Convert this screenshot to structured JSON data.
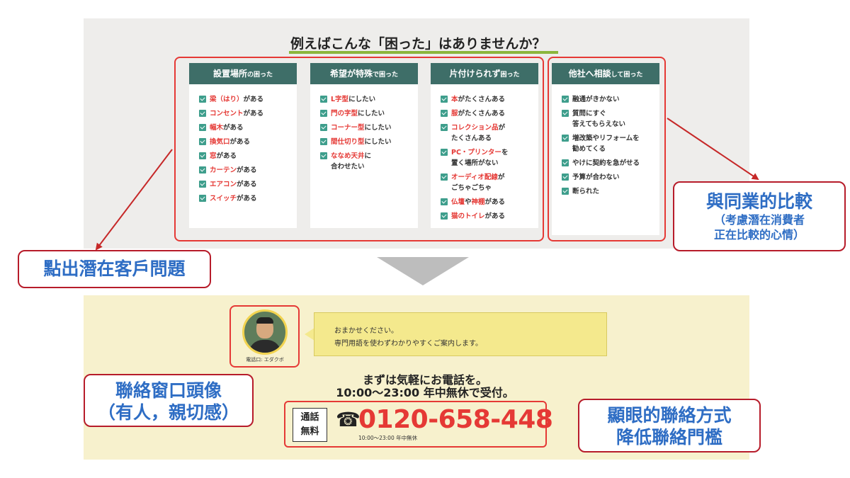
{
  "heading": "例えばこんな「困った」はありませんか？",
  "cards": [
    {
      "title_main": "設置場所",
      "title_sub": "の困った",
      "items": [
        {
          "hl": "梁（はり）",
          "rest": "がある"
        },
        {
          "hl": "コンセント",
          "rest": "がある"
        },
        {
          "hl": "幅木",
          "rest": "がある"
        },
        {
          "hl": "換気口",
          "rest": "がある"
        },
        {
          "hl": "窓",
          "rest": "がある"
        },
        {
          "hl": "カーテン",
          "rest": "がある"
        },
        {
          "hl": "エアコン",
          "rest": "がある"
        },
        {
          "hl": "スイッチ",
          "rest": "がある"
        }
      ]
    },
    {
      "title_main": "希望が特殊",
      "title_sub": "で困った",
      "items": [
        {
          "hl": "L字型",
          "rest": "にしたい"
        },
        {
          "hl": "門の字型",
          "rest": "にしたい"
        },
        {
          "hl": "コーナー型",
          "rest": "にしたい"
        },
        {
          "hl": "間仕切り型",
          "rest": "にしたい"
        },
        {
          "hl": "ななめ天井",
          "rest": "に",
          "line2": "合わせたい"
        }
      ]
    },
    {
      "title_main": "片付けられず",
      "title_sub": "困った",
      "items": [
        {
          "hl": "本",
          "rest": "がたくさんある"
        },
        {
          "hl": "服",
          "rest": "がたくさんある"
        },
        {
          "hl": "コレクション品",
          "rest": "が",
          "line2": "たくさんある"
        },
        {
          "hl": "PC・プリンター",
          "rest": "を",
          "line2": "置く場所がない"
        },
        {
          "hl": "オーディオ配線",
          "rest": "が",
          "line2": "ごちゃごちゃ"
        },
        {
          "hl": "仏壇",
          "mid": "や",
          "hl2": "神棚",
          "rest": "がある"
        },
        {
          "hl": "猫のトイレ",
          "rest": "がある"
        }
      ]
    },
    {
      "title_main": "他社へ相談",
      "title_sub": "して困った",
      "items": [
        {
          "hl": "",
          "rest": "融通がきかない"
        },
        {
          "hl": "",
          "rest": "質問にすぐ",
          "line2": "答えてもらえない"
        },
        {
          "hl": "",
          "rest": "増改築やリフォームを",
          "line2": "勧めてくる"
        },
        {
          "hl": "",
          "rest": "やけに契約を急がせる"
        },
        {
          "hl": "",
          "rest": "予算が合わない"
        },
        {
          "hl": "",
          "rest": "断られた"
        }
      ]
    }
  ],
  "contact": {
    "avatar_caption": "電話口: エダクボ",
    "bubble_line1": "おまかせください。",
    "bubble_line2": "専門用語を使わずわかりやすくご案内します。",
    "callout_line1": "まずは気軽にお電話を。",
    "callout_line2": "10:00～23:00 年中無休で受付。",
    "free_label_1": "通話",
    "free_label_2": "無料",
    "phone_icon": "☎",
    "phone_number": "0120-658-448",
    "phone_hours": "10:00～23:00 年中無休"
  },
  "annotations": {
    "compare_title": "與同業的比較",
    "compare_sub1": "（考慮潛在消費者",
    "compare_sub2": "正在比較的心情）",
    "problem": "點出潛在客戶問題",
    "avatar_line1": "聯絡窗口頭像",
    "avatar_line2": "（有人，親切感）",
    "cta_line1": "顯眼的聯絡方式",
    "cta_line2": "降低聯絡門檻"
  },
  "colors": {
    "card_header": "#3e6e68",
    "check": "#3e9e8c",
    "highlight_red": "#e53935",
    "annotation_text": "#2e6dc4",
    "annotation_border": "#b71c2a"
  }
}
